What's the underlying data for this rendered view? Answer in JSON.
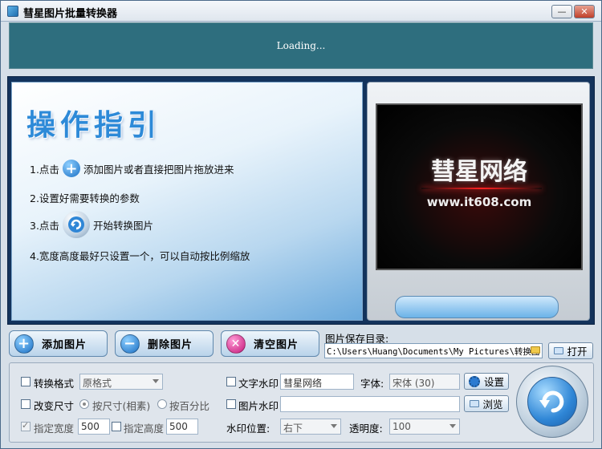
{
  "window": {
    "title": "彗星图片批量转换器",
    "minimize": "—",
    "close": "✕"
  },
  "loading": {
    "text": "Loading..."
  },
  "guide": {
    "title": "操作指引",
    "steps": [
      {
        "prefix": "1.点击",
        "suffix": "添加图片或者直接把图片拖放进来"
      },
      {
        "text": "2.设置好需要转换的参数"
      },
      {
        "prefix": "3.点击",
        "suffix": "开始转换图片"
      },
      {
        "text": "4.宽度高度最好只设置一个，可以自动按比例缩放"
      }
    ]
  },
  "preview": {
    "brand": "彗星网络",
    "url": "www.it608.com"
  },
  "actions": {
    "add": {
      "label": "添加图片",
      "icon": "+"
    },
    "delete": {
      "label": "删除图片",
      "icon": "−"
    },
    "clear": {
      "label": "清空图片",
      "icon": "✕"
    }
  },
  "save": {
    "label": "图片保存目录:",
    "path": "C:\\Users\\Huang\\Documents\\My Pictures\\转换图",
    "open_label": "打开"
  },
  "settings": {
    "convert_format": {
      "label": "转换格式",
      "value": "原格式",
      "checked": false
    },
    "resize": {
      "label": "改变尺寸",
      "checked": false,
      "by_size": "按尺寸(相素)",
      "by_percent": "按百分比"
    },
    "width": {
      "label": "指定宽度",
      "value": "500",
      "checked": true
    },
    "height": {
      "label": "指定高度",
      "value": "500",
      "checked": false
    },
    "text_watermark": {
      "label": "文字水印",
      "value": "彗星网络",
      "checked": false
    },
    "font": {
      "label": "字体:",
      "value": "宋体 (30)"
    },
    "settings_btn": "设置",
    "image_watermark": {
      "label": "图片水印",
      "value": "",
      "checked": false
    },
    "browse_btn": "浏览",
    "position": {
      "label": "水印位置:",
      "value": "右下"
    },
    "opacity": {
      "label": "透明度:",
      "value": "100"
    }
  },
  "colors": {
    "accent": "#2d8ad8",
    "frame": "#13335c",
    "loading_bg": "#2e6e7e"
  }
}
